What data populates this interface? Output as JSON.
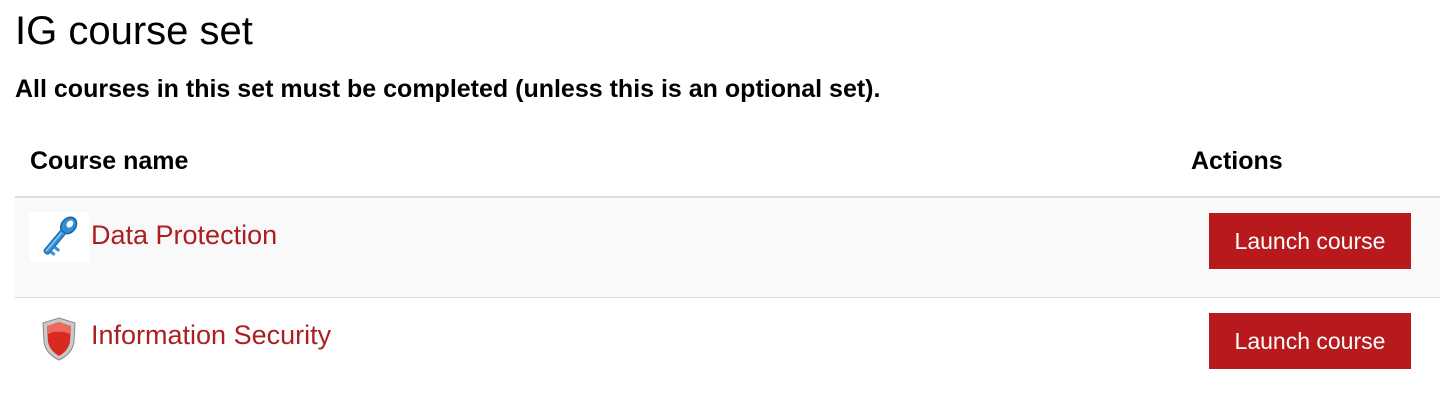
{
  "page": {
    "title": "IG course set",
    "subtitle": "All courses in this set must be completed (unless this is an optional set)."
  },
  "table": {
    "columns": {
      "name": "Course name",
      "actions": "Actions"
    },
    "rows": [
      {
        "name": "Data Protection",
        "icon": "key-icon",
        "action_label": "Launch course"
      },
      {
        "name": "Information Security",
        "icon": "shield-icon",
        "action_label": "Launch course"
      }
    ]
  },
  "colors": {
    "link": "#ab1f23",
    "button": "#b7191d",
    "row_alt": "#f9f9f9",
    "divider": "#dddddd"
  }
}
